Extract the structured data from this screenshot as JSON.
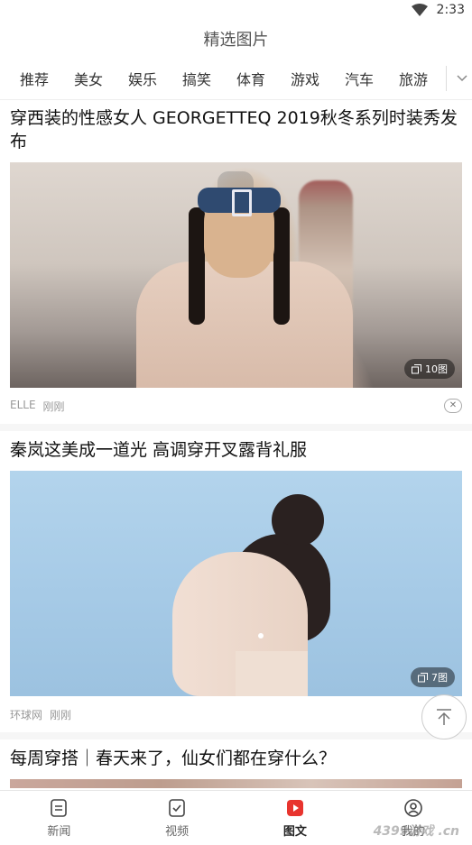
{
  "status": {
    "time": "2:33"
  },
  "header": {
    "title": "精选图片"
  },
  "tabs": [
    "推荐",
    "美女",
    "娱乐",
    "搞笑",
    "体育",
    "游戏",
    "汽车",
    "旅游"
  ],
  "feed": [
    {
      "title": "穿西装的性感女人 GEORGETTEQ 2019秋冬系列时装秀发布",
      "image_count": "10图",
      "source": "ELLE",
      "time": "刚刚"
    },
    {
      "title": "秦岚这美成一道光 高调穿开叉露背礼服",
      "image_count": "7图",
      "source": "环球网",
      "time": "刚刚"
    },
    {
      "title": "每周穿搭｜春天来了，仙女们都在穿什么？"
    }
  ],
  "bottom_nav": [
    {
      "label": "新闻",
      "icon": "news-icon"
    },
    {
      "label": "视频",
      "icon": "video-icon"
    },
    {
      "label": "图文",
      "icon": "photo-article-icon",
      "active": true
    },
    {
      "label": "我的",
      "icon": "profile-icon"
    }
  ],
  "watermark": "4399游戏 .cn",
  "colors": {
    "accent": "#e8342e"
  }
}
